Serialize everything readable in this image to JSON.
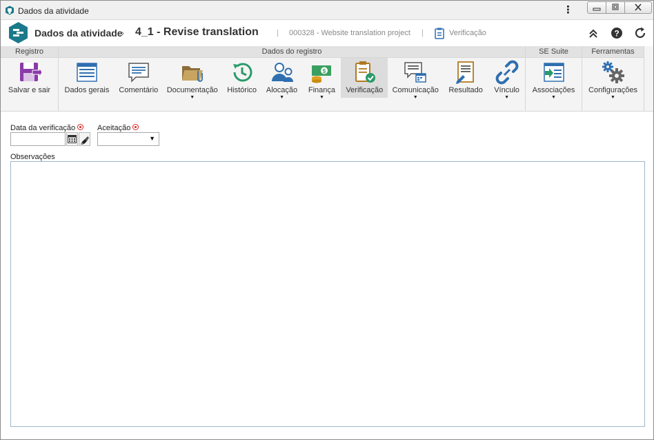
{
  "window": {
    "title": "Dados da atividade",
    "menu_icon": "kebab-menu-icon",
    "controls": [
      "minimize-icon",
      "restore-icon",
      "close-icon"
    ]
  },
  "header": {
    "section": "Dados da atividade",
    "breadcrumb_separator": "›",
    "title": "4_1 - Revise translation",
    "separator": "|",
    "project": "000328 - Website translation project",
    "current_view": "Verificação",
    "actions": [
      "collapse-icon",
      "help-icon",
      "refresh-icon"
    ]
  },
  "ribbon": {
    "groups": [
      {
        "title": "Registro",
        "items": [
          {
            "label": "Salvar e sair",
            "icon": "save-exit-icon",
            "dropdown": false
          }
        ]
      },
      {
        "title": "Dados do registro",
        "items": [
          {
            "label": "Dados gerais",
            "icon": "general-data-icon",
            "dropdown": false
          },
          {
            "label": "Comentário",
            "icon": "comment-icon",
            "dropdown": false
          },
          {
            "label": "Documentação",
            "icon": "documentation-icon",
            "dropdown": true
          },
          {
            "label": "Histórico",
            "icon": "history-icon",
            "dropdown": false
          },
          {
            "label": "Alocação",
            "icon": "allocation-icon",
            "dropdown": true
          },
          {
            "label": "Finança",
            "icon": "finance-icon",
            "dropdown": true
          },
          {
            "label": "Verificação",
            "icon": "verification-icon",
            "dropdown": false,
            "active": true
          },
          {
            "label": "Comunicação",
            "icon": "communication-icon",
            "dropdown": true
          },
          {
            "label": "Resultado",
            "icon": "result-icon",
            "dropdown": false
          },
          {
            "label": "Vínculo",
            "icon": "link-icon",
            "dropdown": true
          }
        ]
      },
      {
        "title": "SE Suite",
        "items": [
          {
            "label": "Associações",
            "icon": "associations-icon",
            "dropdown": true
          }
        ]
      },
      {
        "title": "Ferramentas",
        "items": [
          {
            "label": "Configurações",
            "icon": "settings-icon",
            "dropdown": true
          }
        ]
      }
    ]
  },
  "form": {
    "date_label": "Data da verificação",
    "date_value": "",
    "acceptance_label": "Aceitação",
    "acceptance_value": "",
    "observations_label": "Observações",
    "observations_value": ""
  },
  "colors": {
    "accent": "#1a7a8a",
    "required": "#e02020",
    "ribbon_bg": "#f4f4f4",
    "group_title_bg": "#e2e2e2"
  }
}
